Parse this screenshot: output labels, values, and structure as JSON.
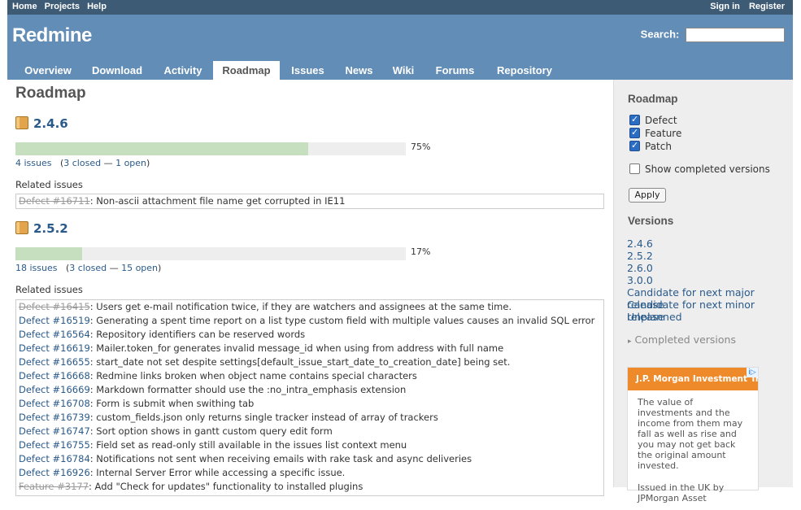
{
  "top_menu": {
    "left": [
      "Home",
      "Projects",
      "Help"
    ],
    "right": [
      "Sign in",
      "Register"
    ]
  },
  "header": {
    "title": "Redmine",
    "search_label": "Search:",
    "search_value": ""
  },
  "tabs": [
    "Overview",
    "Download",
    "Activity",
    "Roadmap",
    "Issues",
    "News",
    "Wiki",
    "Forums",
    "Repository"
  ],
  "selected_tab": "Roadmap",
  "page_title": "Roadmap",
  "versions": [
    {
      "name": "2.4.6",
      "percent": 75,
      "percent_label": "75%",
      "issues": "4 issues",
      "closed": "3 closed",
      "sep": "—",
      "open": "1 open",
      "related_label": "Related issues",
      "issue_list": [
        {
          "id": "Defect #16711",
          "subject": ": Non-ascii attachment file name get corrupted in IE11",
          "closed": true
        }
      ]
    },
    {
      "name": "2.5.2",
      "percent": 17,
      "percent_label": "17%",
      "issues": "18 issues",
      "closed": "3 closed",
      "sep": "—",
      "open": "15 open",
      "related_label": "Related issues",
      "issue_list": [
        {
          "id": "Defect #16415",
          "subject": ": Users get e-mail notification twice, if they are watchers and assignees at the same time.",
          "closed": true
        },
        {
          "id": "Defect #16519",
          "subject": ": Generating a spent time report on a list type custom field with multiple values causes an invalid SQL error",
          "closed": false
        },
        {
          "id": "Defect #16564",
          "subject": ": Repository identifiers can be reserved words",
          "closed": false
        },
        {
          "id": "Defect #16619",
          "subject": ": Mailer.token_for generates invalid message_id when using from address with full name",
          "closed": false
        },
        {
          "id": "Defect #16655",
          "subject": ": start_date not set despite settings[default_issue_start_date_to_creation_date] being set.",
          "closed": false
        },
        {
          "id": "Defect #16668",
          "subject": ": Redmine links broken when object name contains special characters",
          "closed": false
        },
        {
          "id": "Defect #16669",
          "subject": ": Markdown formatter should use the :no_intra_emphasis extension",
          "closed": false
        },
        {
          "id": "Defect #16708",
          "subject": ": Form is submit when swithing tab",
          "closed": false
        },
        {
          "id": "Defect #16739",
          "subject": ": custom_fields.json only returns single tracker instead of array of trackers",
          "closed": false
        },
        {
          "id": "Defect #16747",
          "subject": ": Sort option shows in gantt custom query edit form",
          "closed": false
        },
        {
          "id": "Defect #16755",
          "subject": ": Field set as read-only still available in the issues list context menu",
          "closed": false
        },
        {
          "id": "Defect #16784",
          "subject": ": Notifications not sent when receiving emails with rake task and async deliveries",
          "closed": false
        },
        {
          "id": "Defect #16926",
          "subject": ": Internal Server Error while accessing a specific issue.",
          "closed": false
        },
        {
          "id": "Feature #3177",
          "subject": ": Add \"Check for updates\" functionality to installed plugins",
          "closed": true
        }
      ]
    }
  ],
  "sidebar": {
    "roadmap_title": "Roadmap",
    "trackers": [
      {
        "label": "Defect",
        "checked": true
      },
      {
        "label": "Feature",
        "checked": true
      },
      {
        "label": "Patch",
        "checked": true
      }
    ],
    "show_completed": {
      "label": "Show completed versions",
      "checked": false
    },
    "apply_label": "Apply",
    "versions_title": "Versions",
    "version_links": [
      "2.4.6",
      "2.5.2",
      "2.6.0",
      "3.0.0",
      "Candidate for next major release",
      "Candidate for next minor release",
      "Unplanned"
    ],
    "completed_versions_label": "Completed versions",
    "ad": {
      "headline": "J.P. Morgan Investment Trusts",
      "body": "The value of investments and the income from them may fall as well as rise and you may not get back the original amount invested.",
      "footer": "Issued in the UK by JPMorgan Asset",
      "badge": "i▷"
    }
  },
  "colors": {
    "header_bg": "#628db6",
    "top_bar": "#3e5b76",
    "progress_fill": "#c6dfbf",
    "link": "#2a5a8a"
  }
}
